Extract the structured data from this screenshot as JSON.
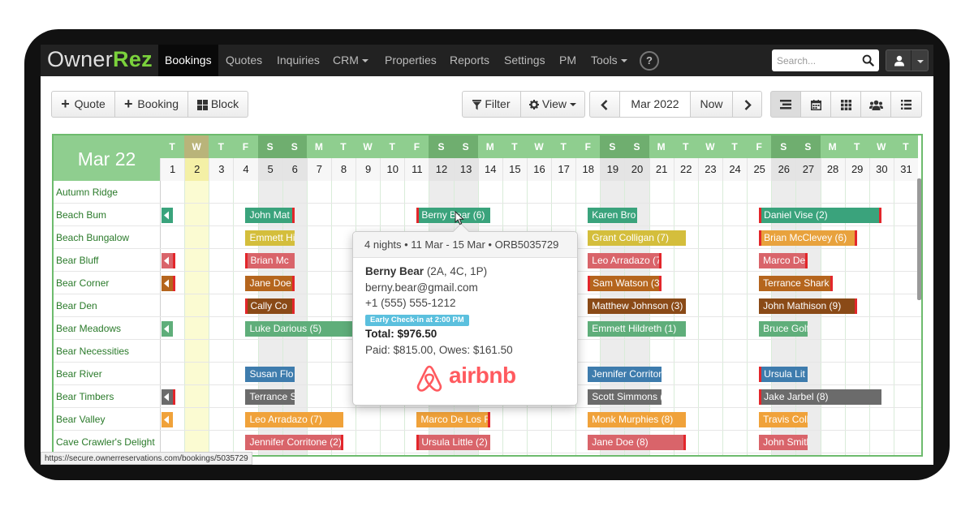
{
  "brand": {
    "name_part1": "Owner",
    "name_part2": "Rez"
  },
  "nav": {
    "items": [
      {
        "label": "Bookings",
        "active": true
      },
      {
        "label": "Quotes"
      },
      {
        "label": "Inquiries"
      },
      {
        "label": "CRM",
        "dropdown": true
      },
      {
        "label": "Properties"
      },
      {
        "label": "Reports"
      },
      {
        "label": "Settings"
      },
      {
        "label": "PM"
      },
      {
        "label": "Tools",
        "dropdown": true
      }
    ],
    "help_label": "?",
    "search_placeholder": "Search..."
  },
  "toolbar": {
    "quote_label": "Quote",
    "booking_label": "Booking",
    "block_label": "Block",
    "filter_label": "Filter",
    "view_label": "View",
    "month_label": "Mar 2022",
    "now_label": "Now"
  },
  "calendar": {
    "title": "Mar 22",
    "days": [
      {
        "d": "T",
        "n": "1"
      },
      {
        "d": "W",
        "n": "2"
      },
      {
        "d": "T",
        "n": "3"
      },
      {
        "d": "F",
        "n": "4"
      },
      {
        "d": "S",
        "n": "5"
      },
      {
        "d": "S",
        "n": "6"
      },
      {
        "d": "M",
        "n": "7"
      },
      {
        "d": "T",
        "n": "8"
      },
      {
        "d": "W",
        "n": "9"
      },
      {
        "d": "T",
        "n": "10"
      },
      {
        "d": "F",
        "n": "11"
      },
      {
        "d": "S",
        "n": "12"
      },
      {
        "d": "S",
        "n": "13"
      },
      {
        "d": "M",
        "n": "14"
      },
      {
        "d": "T",
        "n": "15"
      },
      {
        "d": "W",
        "n": "16"
      },
      {
        "d": "T",
        "n": "17"
      },
      {
        "d": "F",
        "n": "18"
      },
      {
        "d": "S",
        "n": "19"
      },
      {
        "d": "S",
        "n": "20"
      },
      {
        "d": "M",
        "n": "21"
      },
      {
        "d": "T",
        "n": "22"
      },
      {
        "d": "W",
        "n": "23"
      },
      {
        "d": "T",
        "n": "24"
      },
      {
        "d": "F",
        "n": "25"
      },
      {
        "d": "S",
        "n": "26"
      },
      {
        "d": "S",
        "n": "27"
      },
      {
        "d": "M",
        "n": "28"
      },
      {
        "d": "T",
        "n": "29"
      },
      {
        "d": "W",
        "n": "30"
      },
      {
        "d": "T",
        "n": "31"
      }
    ],
    "today": "2",
    "properties": [
      "Autumn Ridge",
      "Beach Bum",
      "Beach Bungalow",
      "Bear Bluff",
      "Bear Corner",
      "Bear Den",
      "Bear Meadows",
      "Bear Necessities",
      "Bear River",
      "Bear Timbers",
      "Bear Valley",
      "Cave Crawler's Delight"
    ],
    "stubs": [
      {
        "row": 1,
        "color": "#3aa37c",
        "flag": false
      },
      {
        "row": 3,
        "color": "#d9646a",
        "flag": true
      },
      {
        "row": 4,
        "color": "#b5651d",
        "flag": true
      },
      {
        "row": 6,
        "color": "#5fae7a",
        "flag": false
      },
      {
        "row": 9,
        "color": "#6b6b6b",
        "flag": true
      },
      {
        "row": 10,
        "color": "#f0a23a",
        "flag": false
      }
    ],
    "bookings": [
      {
        "row": 1,
        "start": 4,
        "end": 6,
        "label": "John Mat",
        "color": "#3aa37c",
        "r": true
      },
      {
        "row": 1,
        "start": 11,
        "end": 14,
        "label": "Berny Bear (6)",
        "color": "#3aa37c",
        "l": true
      },
      {
        "row": 1,
        "start": 18,
        "end": 20,
        "label": "Karen Bro",
        "color": "#3aa37c"
      },
      {
        "row": 1,
        "start": 25,
        "end": 30,
        "label": "Daniel Vise (2)",
        "color": "#3aa37c",
        "l": true,
        "r": true
      },
      {
        "row": 2,
        "start": 4,
        "end": 6,
        "label": "Emmett Hi",
        "color": "#d4be3c"
      },
      {
        "row": 2,
        "start": 18,
        "end": 22,
        "label": "Grant Colligan (7)",
        "color": "#d4be3c"
      },
      {
        "row": 2,
        "start": 25,
        "end": 29,
        "label": "Brian McClevey (6)",
        "color": "#e8a23d",
        "l": true,
        "r": true
      },
      {
        "row": 3,
        "start": 4,
        "end": 6,
        "label": "Brian Mc",
        "color": "#d9646a",
        "l": true
      },
      {
        "row": 3,
        "start": 18,
        "end": 21,
        "label": "Leo Arradazo (7)",
        "color": "#d9646a",
        "r": true
      },
      {
        "row": 3,
        "start": 25,
        "end": 27,
        "label": "Marco De",
        "color": "#d9646a",
        "r": true
      },
      {
        "row": 4,
        "start": 4,
        "end": 6,
        "label": "Jane Doe",
        "color": "#b5651d",
        "r": true
      },
      {
        "row": 4,
        "start": 18,
        "end": 21,
        "label": "Sam Watson (3)",
        "color": "#b5651d",
        "l": true,
        "r": true
      },
      {
        "row": 4,
        "start": 25,
        "end": 28,
        "label": "Terrance Shark (",
        "color": "#b5651d",
        "r": true
      },
      {
        "row": 5,
        "start": 4,
        "end": 6,
        "label": "Cally Co",
        "color": "#8a4a17",
        "l": true,
        "r": true
      },
      {
        "row": 5,
        "start": 18,
        "end": 22,
        "label": "Matthew Johnson (3)",
        "color": "#8a4a17"
      },
      {
        "row": 5,
        "start": 25,
        "end": 29,
        "label": "John Mathison (9)",
        "color": "#8a4a17",
        "r": true
      },
      {
        "row": 6,
        "start": 4,
        "end": 9,
        "label": "Luke Darious (5)",
        "color": "#5fae7a"
      },
      {
        "row": 6,
        "start": 18,
        "end": 22,
        "label": "Emmett Hildreth (1)",
        "color": "#5fae7a"
      },
      {
        "row": 6,
        "start": 25,
        "end": 27,
        "label": "Bruce Golf",
        "color": "#5fae7a"
      },
      {
        "row": 8,
        "start": 4,
        "end": 6,
        "label": "Susan Flo",
        "color": "#3e7cad"
      },
      {
        "row": 8,
        "start": 18,
        "end": 21,
        "label": "Jennifer Corriton",
        "color": "#3e7cad"
      },
      {
        "row": 8,
        "start": 25,
        "end": 27,
        "label": "Ursula Lit",
        "color": "#3e7cad",
        "l": true
      },
      {
        "row": 9,
        "start": 4,
        "end": 6,
        "label": "Terrance Shark (",
        "color": "#6b6b6b"
      },
      {
        "row": 9,
        "start": 18,
        "end": 21,
        "label": "Scott Simmons (3)",
        "color": "#6b6b6b"
      },
      {
        "row": 9,
        "start": 25,
        "end": 30,
        "label": "Jake Jarbel (8)",
        "color": "#6b6b6b",
        "l": true
      },
      {
        "row": 10,
        "start": 4,
        "end": 8,
        "label": "Leo Arradazo (7)",
        "color": "#f0a23a"
      },
      {
        "row": 10,
        "start": 11,
        "end": 14,
        "label": "Marco De Los F",
        "color": "#f0a23a",
        "r": true
      },
      {
        "row": 10,
        "start": 18,
        "end": 22,
        "label": "Monk Murphies (8)",
        "color": "#f0a23a"
      },
      {
        "row": 10,
        "start": 25,
        "end": 27,
        "label": "Travis Coll",
        "color": "#f0a23a"
      },
      {
        "row": 11,
        "start": 4,
        "end": 8,
        "label": "Jennifer Corritone (2)",
        "color": "#d9646a",
        "r": true
      },
      {
        "row": 11,
        "start": 11,
        "end": 14,
        "label": "Ursula Little (2)",
        "color": "#d9646a",
        "l": true
      },
      {
        "row": 11,
        "start": 18,
        "end": 22,
        "label": "Jane Doe (8)",
        "color": "#d9646a",
        "r": true
      },
      {
        "row": 11,
        "start": 25,
        "end": 27,
        "label": "John Smith",
        "color": "#d9646a"
      }
    ]
  },
  "popup": {
    "header": "4 nights • 11 Mar - 15 Mar • ORB5035729",
    "guest_name": "Berny Bear",
    "guest_party": "(2A, 4C, 1P)",
    "email": "berny.bear@gmail.com",
    "phone": "+1 (555) 555-1212",
    "badge": "Early Check-in at 2:00 PM",
    "total_label": "Total:",
    "total_value": "$976.50",
    "paid_line": "Paid: $815.00, Owes: $161.50",
    "channel": "airbnb",
    "channel_color": "#ff5a5f"
  },
  "status_url": "https://secure.ownerreservations.com/bookings/5035729",
  "colors": {
    "header_green": "#8fce8f",
    "weekend_header": "#6fae6f",
    "today_header": "#b9b47a",
    "weekend_bg": "#ececec",
    "today_bg": "#fbfbd2"
  }
}
